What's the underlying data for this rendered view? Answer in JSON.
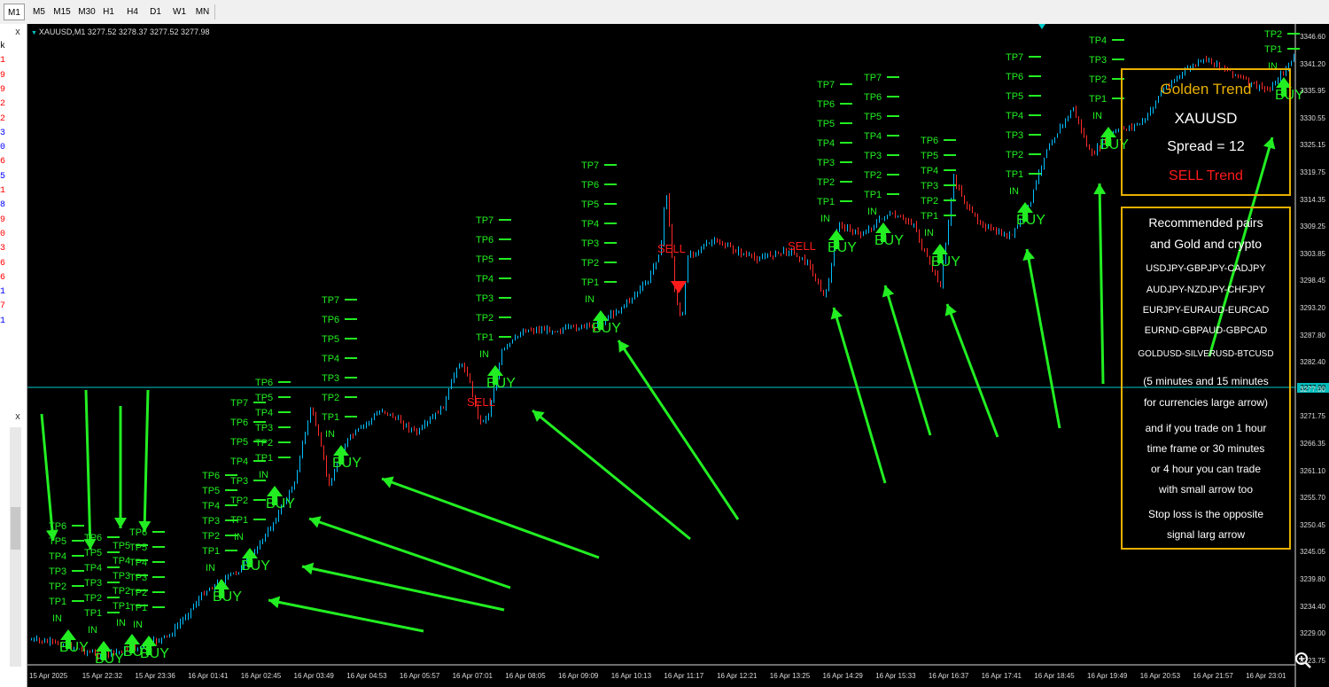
{
  "toolbar": {
    "timeframes": [
      "M1",
      "M5",
      "M15",
      "M30",
      "H1",
      "H4",
      "D1",
      "W1",
      "MN"
    ],
    "active": "M1"
  },
  "left_panel": {
    "close_glyph": "x",
    "rows": [
      {
        "text": "k",
        "color": "#000000"
      },
      {
        "text": "1",
        "color": "#ff0000"
      },
      {
        "text": "9",
        "color": "#ff0000"
      },
      {
        "text": "9",
        "color": "#ff0000"
      },
      {
        "text": "2",
        "color": "#ff0000"
      },
      {
        "text": "2",
        "color": "#ff0000"
      },
      {
        "text": "3",
        "color": "#0000ff"
      },
      {
        "text": "0",
        "color": "#0000ff"
      },
      {
        "text": "6",
        "color": "#ff0000"
      },
      {
        "text": "5",
        "color": "#0000ff"
      },
      {
        "text": "1",
        "color": "#ff0000"
      },
      {
        "text": "8",
        "color": "#0000ff"
      },
      {
        "text": "9",
        "color": "#ff0000"
      },
      {
        "text": "0",
        "color": "#ff0000"
      },
      {
        "text": "3",
        "color": "#ff0000"
      },
      {
        "text": "6",
        "color": "#ff0000"
      },
      {
        "text": "6",
        "color": "#ff0000"
      },
      {
        "text": "1",
        "color": "#0000ff"
      },
      {
        "text": "7",
        "color": "#ff0000"
      },
      {
        "text": "1",
        "color": "#0000ff"
      }
    ]
  },
  "chart": {
    "header": "XAUUSD,M1  3277.52 3278.37 3277.52 3277.98",
    "current_price": "3277.98",
    "price_labels": [
      "3346.60",
      "3341.20",
      "3335.95",
      "3330.55",
      "3325.15",
      "3319.75",
      "3314.35",
      "3309.25",
      "3303.85",
      "3298.45",
      "3293.20",
      "3287.80",
      "3282.40",
      "3277.00",
      "3271.75",
      "3266.35",
      "3261.10",
      "3255.70",
      "3250.45",
      "3245.05",
      "3239.80",
      "3234.40",
      "3229.00",
      "3223.75"
    ],
    "time_labels": [
      "15 Apr 2025",
      "15 Apr 22:32",
      "15 Apr 23:36",
      "16 Apr 01:41",
      "16 Apr 02:45",
      "16 Apr 03:49",
      "16 Apr 04:53",
      "16 Apr 05:57",
      "16 Apr 07:01",
      "16 Apr 08:05",
      "16 Apr 09:09",
      "16 Apr 10:13",
      "16 Apr 11:17",
      "16 Apr 12:21",
      "16 Apr 13:25",
      "16 Apr 14:29",
      "16 Apr 15:33",
      "16 Apr 16:37",
      "16 Apr 17:41",
      "16 Apr 18:45",
      "16 Apr 19:49",
      "16 Apr 20:53",
      "16 Apr 21:57",
      "16 Apr 23:01"
    ],
    "signal_labels": {
      "buy": "BUY",
      "sell": "SELL",
      "entry": "IN"
    },
    "tp_labels": [
      "TP1",
      "TP2",
      "TP3",
      "TP4",
      "TP5",
      "TP6",
      "TP7"
    ],
    "colors": {
      "bull": "#00bfff",
      "bear": "#ff2a2a",
      "signal": "#22ee22",
      "sell": "#ff1a1a",
      "grid_price_line": "#00c8c8",
      "box_border": "#e8b000"
    }
  },
  "info_box": {
    "title": "Golden Trend",
    "symbol": "XAUUSD",
    "spread": "Spread = 12",
    "trend": "SELL Trend"
  },
  "recommend_box": {
    "lines": [
      {
        "text": "Recommended pairs",
        "size": 14
      },
      {
        "text": "and Gold and crypto",
        "size": 14
      },
      {
        "text": "USDJPY-GBPJPY-CADJPY",
        "size": 11
      },
      {
        "text": "AUDJPY-NZDJPY-CHFJPY",
        "size": 11
      },
      {
        "text": "EURJPY-EURAUD-EURCAD",
        "size": 11
      },
      {
        "text": "EURND-GBPAUD-GBPCAD",
        "size": 11
      },
      {
        "text": "GOLDUSD-SILVERUSD-BTCUSD",
        "size": 10
      },
      {
        "text": "(5 minutes and 15 minutes",
        "size": 12
      },
      {
        "text": "for currencies large arrow)",
        "size": 12
      },
      {
        "text": "and if you trade on 1 hour",
        "size": 12
      },
      {
        "text": "time frame or 30 minutes",
        "size": 12
      },
      {
        "text": "or 4 hour you can trade",
        "size": 12
      },
      {
        "text": "with small arrow too",
        "size": 12
      },
      {
        "text": "Stop loss is the opposite",
        "size": 12
      },
      {
        "text": "signal larg arrow",
        "size": 12
      }
    ]
  },
  "zoom_icon": "zoom-in-icon"
}
